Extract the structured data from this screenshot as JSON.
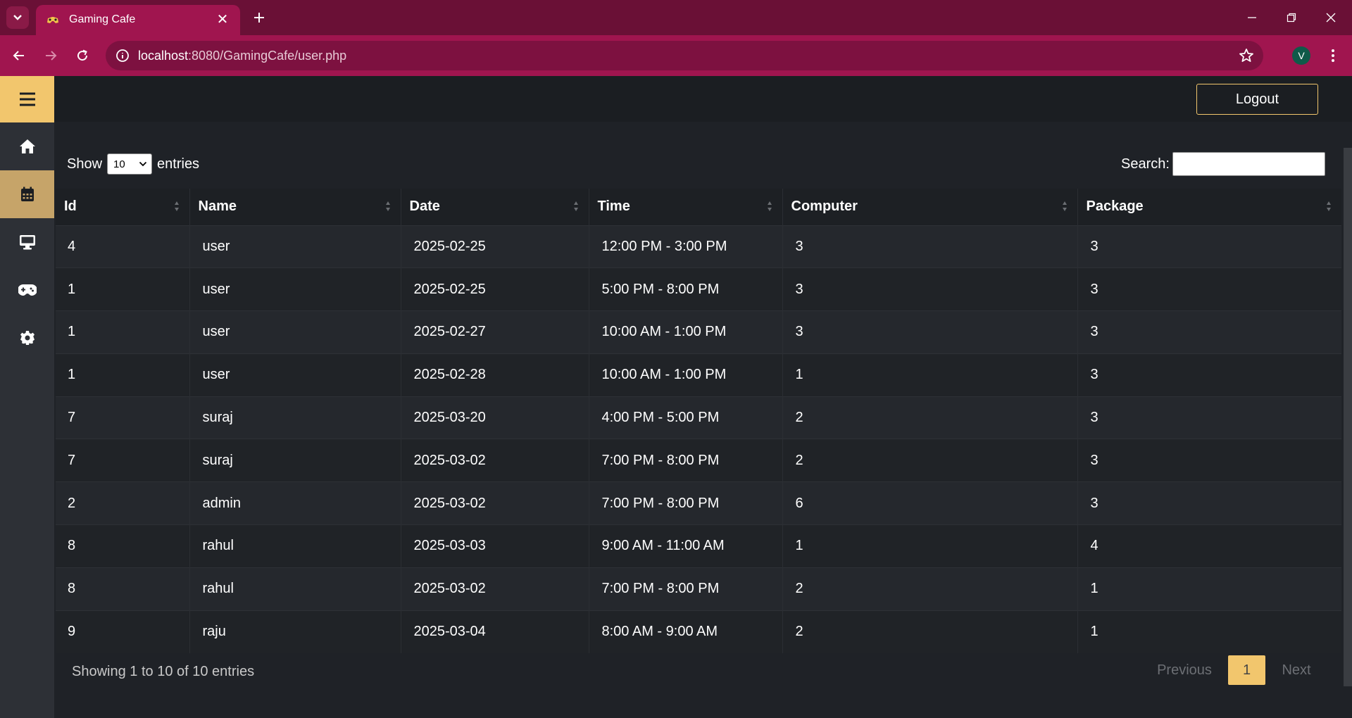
{
  "browser": {
    "tab_title": "Gaming Cafe",
    "url_host": "localhost",
    "url_rest": ":8080/GamingCafe/user.php",
    "profile_initial": "V"
  },
  "sidebar": {
    "items": [
      {
        "icon": "hamburger-menu-icon"
      },
      {
        "icon": "home-icon"
      },
      {
        "icon": "calendar-icon",
        "active": true
      },
      {
        "icon": "desktop-icon"
      },
      {
        "icon": "gamepad-icon"
      },
      {
        "icon": "gear-icon"
      }
    ]
  },
  "header": {
    "logout_label": "Logout"
  },
  "controls": {
    "show_label": "Show",
    "entries_value": "10",
    "entries_label": "entries",
    "search_label": "Search:",
    "search_value": ""
  },
  "table": {
    "columns": [
      "Id",
      "Name",
      "Date",
      "Time",
      "Computer",
      "Package"
    ],
    "rows": [
      [
        "4",
        "user",
        "2025-02-25",
        "12:00 PM - 3:00 PM",
        "3",
        "3"
      ],
      [
        "1",
        "user",
        "2025-02-25",
        "5:00 PM - 8:00 PM",
        "3",
        "3"
      ],
      [
        "1",
        "user",
        "2025-02-27",
        "10:00 AM - 1:00 PM",
        "3",
        "3"
      ],
      [
        "1",
        "user",
        "2025-02-28",
        "10:00 AM - 1:00 PM",
        "1",
        "3"
      ],
      [
        "7",
        "suraj",
        "2025-03-20",
        "4:00 PM - 5:00 PM",
        "2",
        "3"
      ],
      [
        "7",
        "suraj",
        "2025-03-02",
        "7:00 PM - 8:00 PM",
        "2",
        "3"
      ],
      [
        "2",
        "admin",
        "2025-03-02",
        "7:00 PM - 8:00 PM",
        "6",
        "3"
      ],
      [
        "8",
        "rahul",
        "2025-03-03",
        "9:00 AM - 11:00 AM",
        "1",
        "4"
      ],
      [
        "8",
        "rahul",
        "2025-03-02",
        "7:00 PM - 8:00 PM",
        "2",
        "1"
      ],
      [
        "9",
        "raju",
        "2025-03-04",
        "8:00 AM - 9:00 AM",
        "2",
        "1"
      ]
    ]
  },
  "footer": {
    "info": "Showing 1 to 10 of 10 entries",
    "previous_label": "Previous",
    "current_page": "1",
    "next_label": "Next"
  },
  "colors": {
    "accent": "#f2c66d",
    "chrome": "#a0154f",
    "background": "#1f2227"
  }
}
